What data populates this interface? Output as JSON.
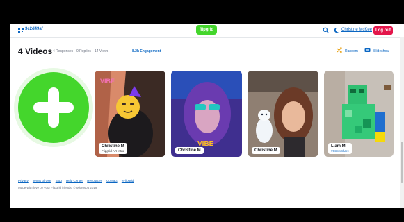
{
  "header": {
    "brand_code": "3c2d49af",
    "logo_text": "flipgrid",
    "user_name": "Christine McKee",
    "logout_label": "Log out"
  },
  "topic": {
    "title": "4 Videos",
    "responses": "4 Responses",
    "replies": "0 Replies",
    "views": "14 Views",
    "engagement": "8.2h Engagement",
    "random_label": "Random",
    "slideshow_label": "Slideshow"
  },
  "cards": [
    {
      "name": "Christine M",
      "subtitle": "Flipgrid AR Intro"
    },
    {
      "name": "Christine M",
      "subtitle": ""
    },
    {
      "name": "Christine M",
      "subtitle": ""
    },
    {
      "name": "Liam M",
      "subtitle": "#StrowShare"
    }
  ],
  "footer": {
    "links": [
      "Privacy",
      "Terms of Use",
      "Blog",
      "Help Center",
      "Resources",
      "Contact",
      "#Flipgrid"
    ],
    "note": "Made with love by your Flipgrid friends. © Microsoft 2019"
  },
  "colors": {
    "brand_green": "#44d62c",
    "logout_red": "#e3164b",
    "link_blue": "#0a66c2"
  }
}
